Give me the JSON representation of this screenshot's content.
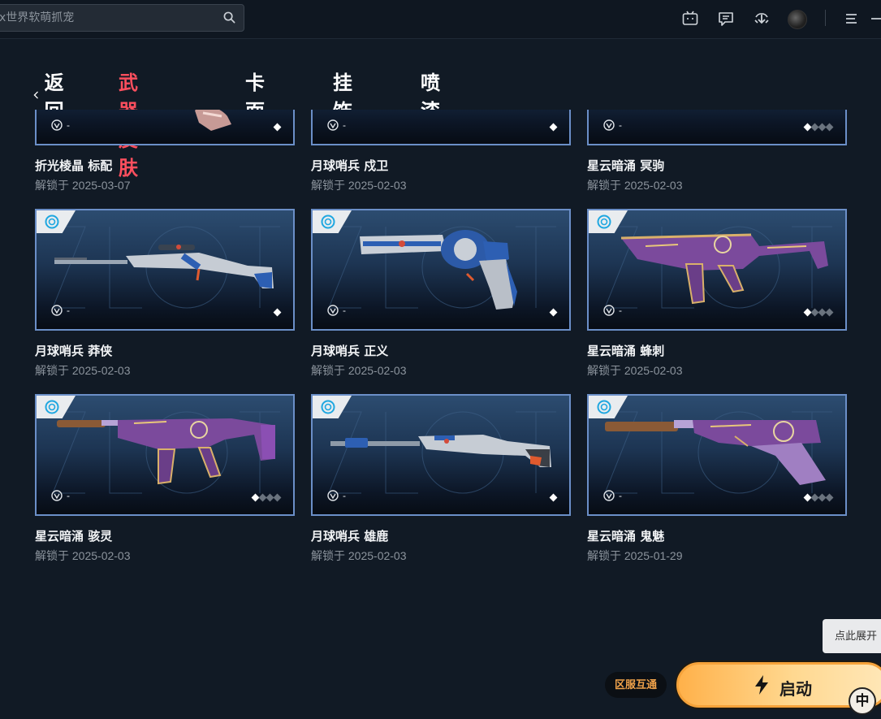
{
  "search": {
    "placeholder": "x世界软萌抓宠"
  },
  "topbar": {
    "icons": [
      "bilibili-tv-icon",
      "feedback-icon",
      "download-icon",
      "user-avatar",
      "menu-icon",
      "minimize-icon"
    ]
  },
  "nav": {
    "back_label": "返回",
    "tabs": [
      {
        "label": "武器皮肤",
        "active": true
      },
      {
        "label": "卡面",
        "active": false
      },
      {
        "label": "挂饰",
        "active": false
      },
      {
        "label": "喷漆",
        "active": false
      }
    ]
  },
  "skins": [
    {
      "name": "折光棱晶 标配",
      "unlock": "解锁于 2025-03-07",
      "fav": "-",
      "rarity_on": 1,
      "rarity_total": 1,
      "weapon": "classic-pistol"
    },
    {
      "name": "月球哨兵 戍卫",
      "unlock": "解锁于 2025-02-03",
      "fav": "-",
      "rarity_on": 1,
      "rarity_total": 1,
      "weapon": "guardian"
    },
    {
      "name": "星云暗涌 冥驹",
      "unlock": "解锁于 2025-02-03",
      "fav": "-",
      "rarity_on": 1,
      "rarity_total": 4,
      "weapon": "phantom"
    },
    {
      "name": "月球哨兵 莽侠",
      "unlock": "解锁于 2025-02-03",
      "fav": "-",
      "rarity_on": 1,
      "rarity_total": 1,
      "weapon": "marshal"
    },
    {
      "name": "月球哨兵 正义",
      "unlock": "解锁于 2025-02-03",
      "fav": "-",
      "rarity_on": 1,
      "rarity_total": 1,
      "weapon": "sheriff"
    },
    {
      "name": "星云暗涌 蜂刺",
      "unlock": "解锁于 2025-02-03",
      "fav": "-",
      "rarity_on": 1,
      "rarity_total": 4,
      "weapon": "stinger"
    },
    {
      "name": "星云暗涌 骇灵",
      "unlock": "解锁于 2025-02-03",
      "fav": "-",
      "rarity_on": 1,
      "rarity_total": 4,
      "weapon": "spectre"
    },
    {
      "name": "月球哨兵 雄鹿",
      "unlock": "解锁于 2025-02-03",
      "fav": "-",
      "rarity_on": 1,
      "rarity_total": 1,
      "weapon": "bucky"
    },
    {
      "name": "星云暗涌 鬼魅",
      "unlock": "解锁于 2025-01-29",
      "fav": "-",
      "rarity_on": 1,
      "rarity_total": 4,
      "weapon": "ghost"
    }
  ],
  "expand_tip": "点此展开",
  "region_label": "区服互通",
  "launch_label": "启动",
  "ime_label": "中",
  "colors": {
    "accent": "#ff4f5e",
    "card_border": "#6b8fc8",
    "launch": "#ffb14a",
    "region_text": "#f0a24a"
  }
}
